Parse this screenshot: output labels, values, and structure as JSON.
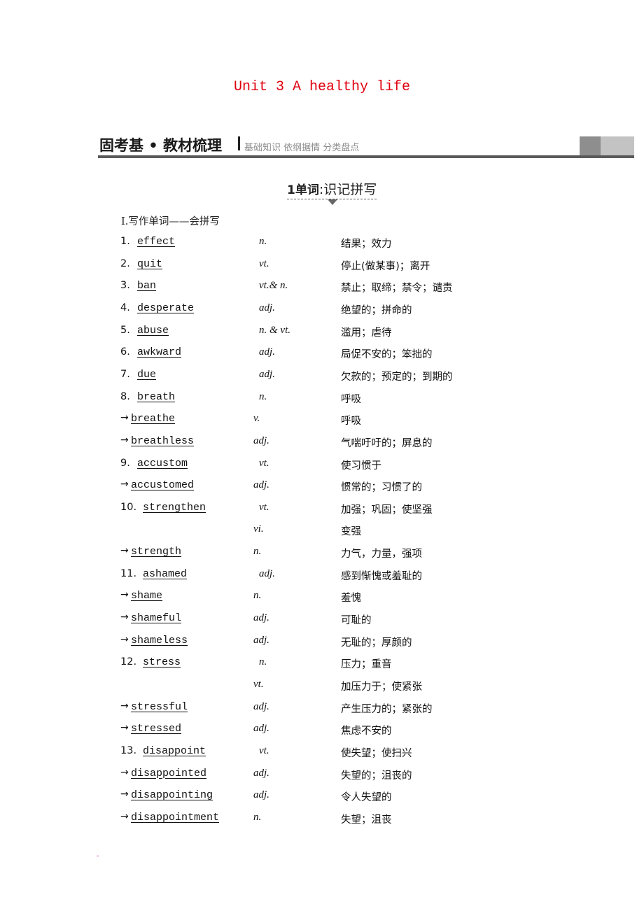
{
  "unit_title": "Unit 3  A healthy life",
  "banner": {
    "title": "固考基 • 教材梳理",
    "subtitle": "基础知识  依纲据情  分类盘点"
  },
  "section": {
    "number": "1",
    "label": "单词",
    "title": "识记拼写"
  },
  "part_title": "Ⅰ.写作单词——会拼写",
  "entries": [
    {
      "prefix": "1.",
      "word": "effect",
      "pos": "n.",
      "meaning": "结果；效力",
      "type": "main"
    },
    {
      "prefix": "2.",
      "word": "quit",
      "pos": "vt.",
      "meaning": "停止(做某事)；离开",
      "type": "main"
    },
    {
      "prefix": "3.",
      "word": "ban",
      "pos": "vt.& n.",
      "meaning": "禁止；取缔；禁令；谴责",
      "type": "main"
    },
    {
      "prefix": "4.",
      "word": "desperate",
      "pos": "adj.",
      "meaning": "绝望的；拼命的",
      "type": "main"
    },
    {
      "prefix": "5.",
      "word": "abuse",
      "pos": "n. & vt.",
      "meaning": "滥用；虐待",
      "type": "main"
    },
    {
      "prefix": "6.",
      "word": "awkward",
      "pos": "adj.",
      "meaning": "局促不安的；笨拙的",
      "type": "main"
    },
    {
      "prefix": "7.",
      "word": "due",
      "pos": "adj.",
      "meaning": "欠款的；预定的；到期的",
      "type": "main"
    },
    {
      "prefix": "8.",
      "word": "breath",
      "pos": "n.",
      "meaning": "呼吸",
      "type": "main"
    },
    {
      "prefix": "→",
      "word": "breathe",
      "pos": "v.",
      "meaning": "呼吸",
      "type": "derived"
    },
    {
      "prefix": "→",
      "word": "breathless",
      "pos": "adj.",
      "meaning": "气喘吁吁的；屏息的",
      "type": "derived"
    },
    {
      "prefix": "9.",
      "word": "accustom",
      "pos": "vt.",
      "meaning": "使习惯于",
      "type": "main"
    },
    {
      "prefix": "→",
      "word": "accustomed",
      "pos": "adj.",
      "meaning": "惯常的；习惯了的",
      "type": "derived"
    },
    {
      "prefix": "10.",
      "word": "strengthen",
      "pos": "vt.",
      "meaning": "加强；巩固；使坚强",
      "type": "main2"
    },
    {
      "prefix": "",
      "word": "",
      "pos": "vi.",
      "meaning": "变强",
      "type": "cont"
    },
    {
      "prefix": "→",
      "word": "strength",
      "pos": "n.",
      "meaning": "力气，力量，强项",
      "type": "derived"
    },
    {
      "prefix": "11.",
      "word": "ashamed",
      "pos": "adj.",
      "meaning": "感到惭愧或羞耻的",
      "type": "main2"
    },
    {
      "prefix": "→",
      "word": "shame",
      "pos": "n.",
      "meaning": "羞愧",
      "type": "derived"
    },
    {
      "prefix": "→",
      "word": "shameful",
      "pos": "adj.",
      "meaning": "可耻的",
      "type": "derived"
    },
    {
      "prefix": "→",
      "word": "shameless",
      "pos": "adj.",
      "meaning": "无耻的；厚颜的",
      "type": "derived"
    },
    {
      "prefix": "12.",
      "word": "stress",
      "pos": "n.",
      "meaning": "压力；重音",
      "type": "main2"
    },
    {
      "prefix": "",
      "word": "",
      "pos": "vt.",
      "meaning": "加压力于；使紧张",
      "type": "cont"
    },
    {
      "prefix": "→",
      "word": "stressful",
      "pos": "adj.",
      "meaning": "产生压力的；紧张的",
      "type": "derived"
    },
    {
      "prefix": "→",
      "word": "stressed",
      "pos": "adj.",
      "meaning": "焦虑不安的",
      "type": "derived"
    },
    {
      "prefix": "13.",
      "word": "disappoint",
      "pos": "vt.",
      "meaning": "使失望；使扫兴",
      "type": "main2"
    },
    {
      "prefix": "→",
      "word": "disappointed",
      "pos": "adj.",
      "meaning": "失望的；沮丧的",
      "type": "derived"
    },
    {
      "prefix": "→",
      "word": "disappointing",
      "pos": "adj.",
      "meaning": "令人失望的",
      "type": "derived"
    },
    {
      "prefix": "→",
      "word": "disappointment",
      "pos": "n.",
      "meaning": "失望；沮丧",
      "type": "derived"
    }
  ]
}
